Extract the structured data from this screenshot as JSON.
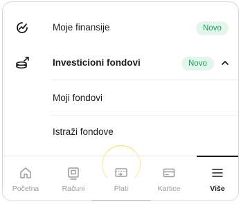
{
  "menu": {
    "items": [
      {
        "label": "Moje finansije",
        "badge": "Novo",
        "icon": "chart-trend-icon"
      },
      {
        "label": "Investicioni fondovi",
        "badge": "Novo",
        "icon": "investment-icon",
        "expanded": true
      }
    ],
    "subitems": [
      {
        "label": "Moji fondovi"
      },
      {
        "label": "Istraži fondove"
      }
    ]
  },
  "bottom_nav": {
    "items": [
      {
        "label": "Početna",
        "icon": "home-icon"
      },
      {
        "label": "Računi",
        "icon": "accounts-icon"
      },
      {
        "label": "Plati",
        "icon": "pay-icon"
      },
      {
        "label": "Kartice",
        "icon": "card-icon"
      },
      {
        "label": "Više",
        "icon": "menu-icon",
        "active": true
      }
    ]
  },
  "colors": {
    "accent_green": "#1aa05a",
    "badge_bg": "#e4f6ec",
    "highlight_ring": "#f2df3e",
    "text": "#1b1b1b"
  }
}
